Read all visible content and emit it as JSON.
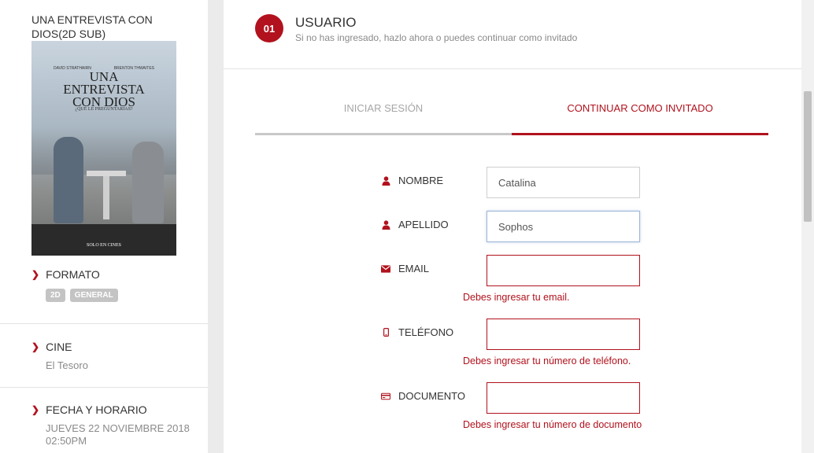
{
  "movie": {
    "title": "UNA ENTREVISTA CON DIOS(2D SUB)",
    "poster": {
      "actor_left": "DAVID STRATHAIRN",
      "actor_right": "BRENTON THWAITES",
      "title_line1": "UNA",
      "title_line2": "ENTREVISTA",
      "title_line3": "CON DIOS",
      "tagline": "¿QUÉ LE PREGUNTARÍAS?",
      "release": "SOLO EN CINES"
    }
  },
  "sidebar": {
    "formato": {
      "label": "FORMATO",
      "badges": [
        "2D",
        "GENERAL"
      ]
    },
    "cine": {
      "label": "CINE",
      "value": "El Tesoro"
    },
    "fecha": {
      "label": "FECHA Y HORARIO",
      "date": "JUEVES 22 NOVIEMBRE 2018",
      "time": "02:50PM"
    }
  },
  "step": {
    "number": "01",
    "title": "USUARIO",
    "subtitle": "Si no has ingresado, hazlo ahora o puedes continuar como invitado"
  },
  "tabs": {
    "login": "INICIAR SESIÓN",
    "guest": "CONTINUAR COMO INVITADO",
    "active": "guest"
  },
  "form": {
    "nombre": {
      "label": "NOMBRE",
      "value": "Catalina"
    },
    "apellido": {
      "label": "APELLIDO",
      "value": "Sophos"
    },
    "email": {
      "label": "EMAIL",
      "value": "",
      "error": "Debes ingresar tu email."
    },
    "telefono": {
      "label": "TELÉFONO",
      "value": "",
      "error": "Debes ingresar tu número de teléfono."
    },
    "documento": {
      "label": "DOCUMENTO",
      "value": "",
      "error": "Debes ingresar tu número de documento"
    }
  },
  "colors": {
    "accent": "#b1121d",
    "muted": "#8a8a8a",
    "background": "#ebebeb"
  }
}
